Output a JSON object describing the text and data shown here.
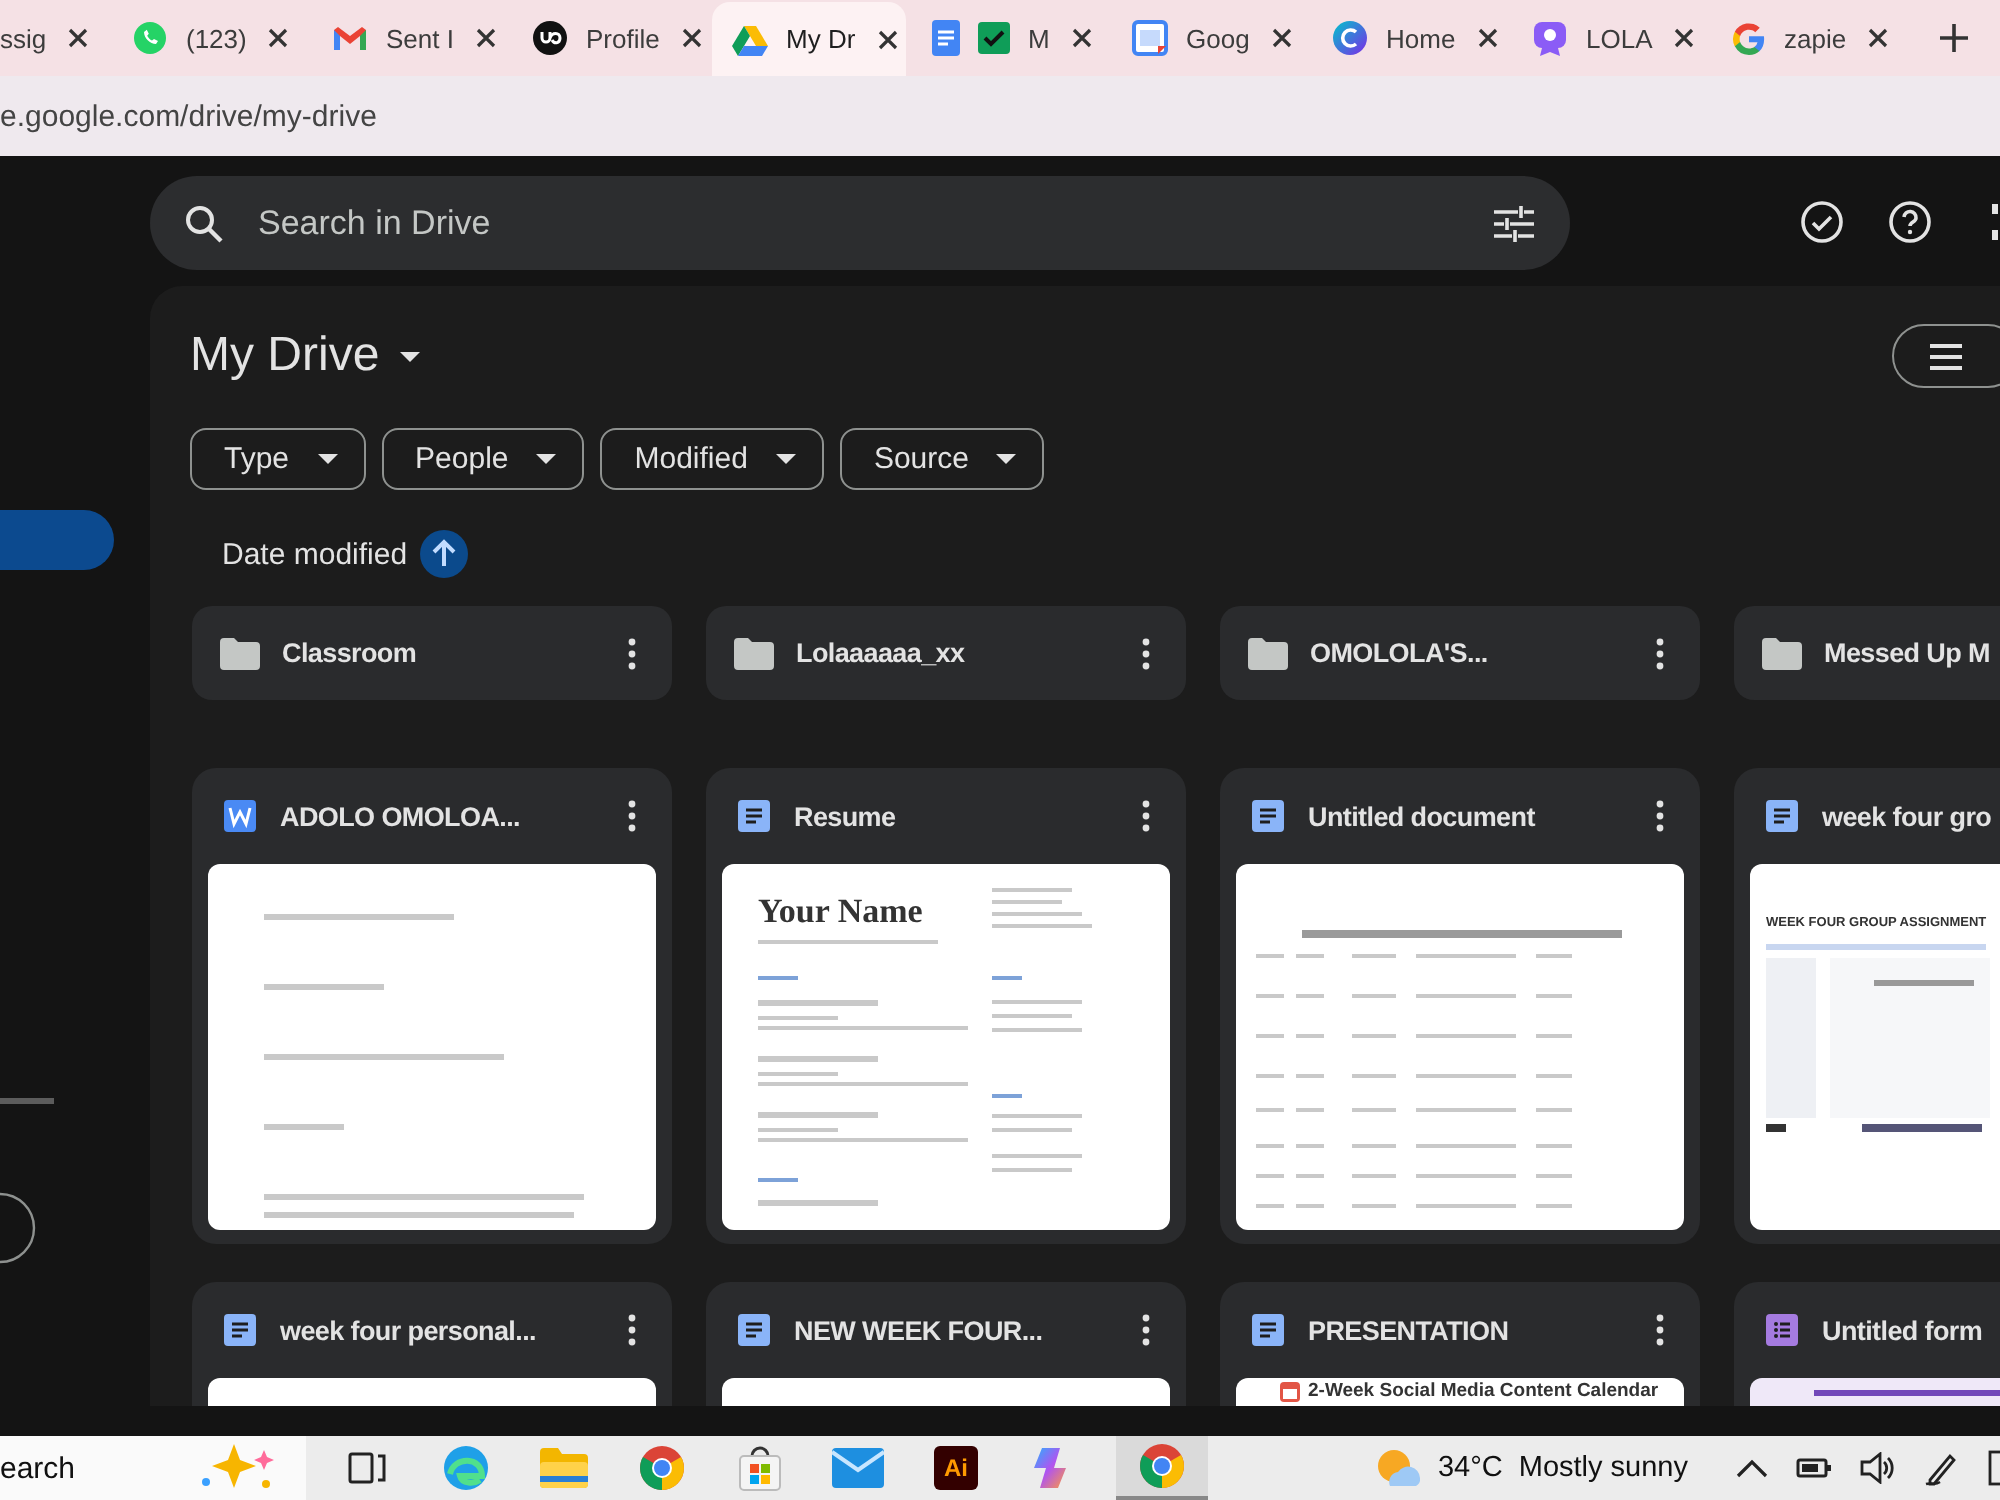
{
  "browser": {
    "tabs": [
      {
        "title": "ssig",
        "selected": false
      },
      {
        "title": "(123)",
        "selected": false
      },
      {
        "title": "Sent I",
        "selected": false
      },
      {
        "title": "Profile",
        "selected": false
      },
      {
        "title": "My Dr",
        "selected": true
      },
      {
        "title": "M",
        "selected": false
      },
      {
        "title": "Goog",
        "selected": false
      },
      {
        "title": "Home",
        "selected": false
      },
      {
        "title": "LOLA",
        "selected": false
      },
      {
        "title": "zapie",
        "selected": false
      }
    ],
    "address": "e.google.com/drive/my-drive"
  },
  "drive": {
    "search": {
      "placeholder": "Search in Drive"
    },
    "title": "My Drive",
    "filters": [
      "Type",
      "People",
      "Modified",
      "Source"
    ],
    "sort": "Date modified",
    "folders": [
      {
        "name": "Classroom"
      },
      {
        "name": "Lolaaaaaa_xx"
      },
      {
        "name": "OMOLOLA'S..."
      },
      {
        "name": "Messed Up M"
      }
    ],
    "files": [
      {
        "name": "ADOLO OMOLOA...",
        "kind": "word",
        "preview": {
          "kind": "letter"
        }
      },
      {
        "name": "Resume",
        "kind": "doc",
        "preview": {
          "kind": "resume",
          "heading": "Your Name"
        }
      },
      {
        "name": "Untitled document",
        "kind": "doc",
        "preview": {
          "kind": "table"
        }
      },
      {
        "name": "week four gro",
        "kind": "doc",
        "preview": {
          "kind": "screenshot",
          "heading": "WEEK FOUR GROUP ASSIGNMENT"
        }
      },
      {
        "name": "week four personal...",
        "kind": "doc",
        "preview": {
          "kind": "blank"
        }
      },
      {
        "name": "NEW WEEK FOUR...",
        "kind": "doc",
        "preview": {
          "kind": "blank"
        }
      },
      {
        "name": "PRESENTATION",
        "kind": "doc",
        "preview": {
          "kind": "calendar",
          "heading": "2-Week Social Media Content Calendar"
        }
      },
      {
        "name": "Untitled form",
        "kind": "form",
        "preview": {
          "kind": "form"
        }
      }
    ]
  },
  "taskbar": {
    "search": "earch",
    "app_label": "Ai",
    "weather": {
      "temperature": "34°C",
      "condition": "Mostly sunny"
    }
  }
}
